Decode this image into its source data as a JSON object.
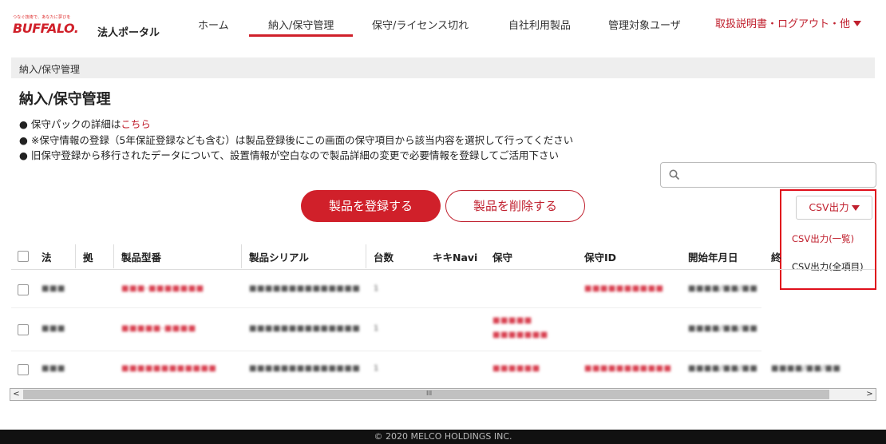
{
  "header": {
    "logo_tagline": "つなぐ技術で、あなたに夢びを",
    "logo_text": "BUFFALO.",
    "portal_name": "法人ポータル",
    "nav": [
      "ホーム",
      "納入/保守管理",
      "保守/ライセンス切れ",
      "自社利用製品",
      "管理対象ユーザ"
    ],
    "active_nav": "納入/保守管理",
    "right_menu": "取扱説明書・ログアウト・他"
  },
  "breadcrumb": "納入/保守管理",
  "page_title": "納入/保守管理",
  "notes": {
    "line1_prefix": "保守パックの詳細は",
    "line1_link": "こちら",
    "line2": "※保守情報の登録（5年保証登録なども含む）は製品登録後にこの画面の保守項目から該当内容を選択して行ってください",
    "line3": "旧保守登録から移行されたデータについて、設置情報が空白なので製品詳細の変更で必要情報を登録してご活用下さい"
  },
  "search": {
    "placeholder": ""
  },
  "buttons": {
    "register": "製品を登録する",
    "delete": "製品を削除する",
    "csv": "CSV出力"
  },
  "csv_menu": [
    "CSV出力(一覧)",
    "CSV出力(全項目)"
  ],
  "table": {
    "columns": [
      "法",
      "拠",
      "製品型番",
      "製品シリアル",
      "台数",
      "キキNavi",
      "保守",
      "保守ID",
      "開始年月日",
      "終"
    ],
    "rows": [
      {
        "c1": "■■■",
        "model": "■■■-■■■■■■■",
        "serial": "■■■■■■■■■■■■■■",
        "qty": "1",
        "hoshu": "",
        "hoshu2": "",
        "hoshu_id": "■■■■■■■■■■",
        "start": "■■■■/■■/■■",
        "end": ""
      },
      {
        "c1": "■■■",
        "model": "■■■■■-■■■■",
        "serial": "■■■■■■■■■■■■■■",
        "qty": "1",
        "hoshu": "■■■■■",
        "hoshu2": "■■■■■■■",
        "hoshu_id": "",
        "start": "■■■■/■■/■■",
        "end": ""
      },
      {
        "c1": "■■■",
        "model": "■■■■■■■■■■■■",
        "serial": "■■■■■■■■■■■■■■",
        "qty": "1",
        "hoshu": "■■■■■■",
        "hoshu2": "",
        "hoshu_id": "■■■■■■■■■■■",
        "start": "■■■■/■■/■■",
        "end": "■■■■/■■/■■"
      }
    ]
  },
  "footer": "© 2020 MELCO HOLDINGS INC."
}
